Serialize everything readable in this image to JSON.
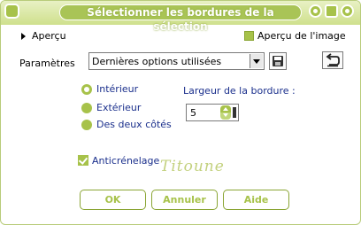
{
  "window": {
    "title": "Sélectionner les bordures de la sélection"
  },
  "preview": {
    "toggle_label": "Aperçu",
    "image_preview_label": "Aperçu de l'image",
    "image_preview_checked": true
  },
  "settings": {
    "label": "Paramètres",
    "preset_value": "Dernières options utilisées"
  },
  "border": {
    "options": [
      {
        "label": "Intérieur",
        "selected": true
      },
      {
        "label": "Extérieur",
        "selected": false
      },
      {
        "label": "Des deux côtés",
        "selected": false
      }
    ],
    "width_label": "Largeur de la bordure :",
    "width_value": "5"
  },
  "antialias": {
    "label": "Anticrénelage",
    "checked": true
  },
  "watermark_text": "Titoune",
  "buttons": {
    "ok": "OK",
    "cancel": "Annuler",
    "help": "Aide"
  },
  "colors": {
    "accent": "#a7c24a",
    "label_blue": "#1a2f8c"
  }
}
